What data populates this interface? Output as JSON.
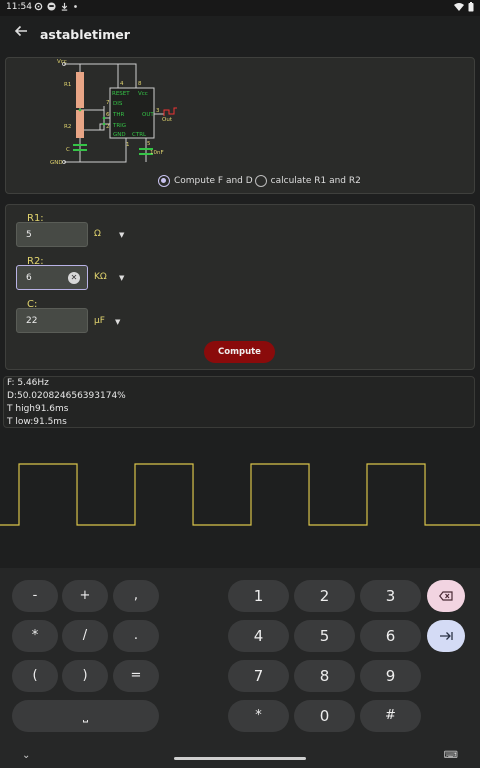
{
  "status": {
    "time": "11:54",
    "left_icons": [
      "gear-icon",
      "face-icon",
      "download-icon",
      "dot-icon"
    ],
    "right_icons": [
      "wifi-icon",
      "battery-icon"
    ]
  },
  "appbar": {
    "title": "astabletimer"
  },
  "circuit": {
    "vcc_label": "Vcc",
    "r1_label": "R1",
    "r2_label": "R2",
    "c_label": "C",
    "gnd_label": "GND",
    "pin_reset": "RESET",
    "pin_vcc": "Vcc",
    "pin_dis": "DIS",
    "pin_thr": "THR",
    "pin_trig": "TRIG",
    "pin_gnd": "GND",
    "pin_out": "OUT",
    "pin_ctrl": "CTRL",
    "pin4": "4",
    "pin8": "8",
    "pin7": "7",
    "pin6": "6",
    "pin2": "2",
    "pin3": "3",
    "pin1": "1",
    "pin5": "5",
    "out_label": "Out",
    "cap_label": "10nF"
  },
  "mode": {
    "option1": "Compute F and D",
    "option2": "calculate R1 and R2",
    "selected": "option1"
  },
  "inputs": {
    "r1": {
      "label": "R1:",
      "value": "5",
      "unit": "Ω"
    },
    "r2": {
      "label": "R2:",
      "value": "6",
      "unit": "KΩ"
    },
    "c": {
      "label": "C:",
      "value": "22",
      "unit": "µF"
    },
    "dropdown_glyph": "▼",
    "clear_glyph": "✕"
  },
  "compute_label": "Compute",
  "results": {
    "f": "F: 5.46Hz",
    "d": "D:50.020824656393174%",
    "t_high": "T high91.6ms",
    "t_low": "T low:91.5ms"
  },
  "waveform": {
    "color": "#d9c34a",
    "high_fraction": 0.5002
  },
  "keyboard": {
    "rows": [
      [
        "-",
        "+",
        ","
      ],
      [
        "*",
        "/",
        "."
      ],
      [
        "(",
        ")",
        "="
      ]
    ],
    "space_glyph": "⎵",
    "numpad": [
      [
        "1",
        "2",
        "3"
      ],
      [
        "4",
        "5",
        "6"
      ],
      [
        "7",
        "8",
        "9"
      ],
      [
        "*",
        "0",
        "#"
      ]
    ],
    "delete_icon": "backspace-icon",
    "tab_icon": "tab-icon",
    "hide_glyph": "⌄",
    "keyboard_glyph": "⌨"
  }
}
